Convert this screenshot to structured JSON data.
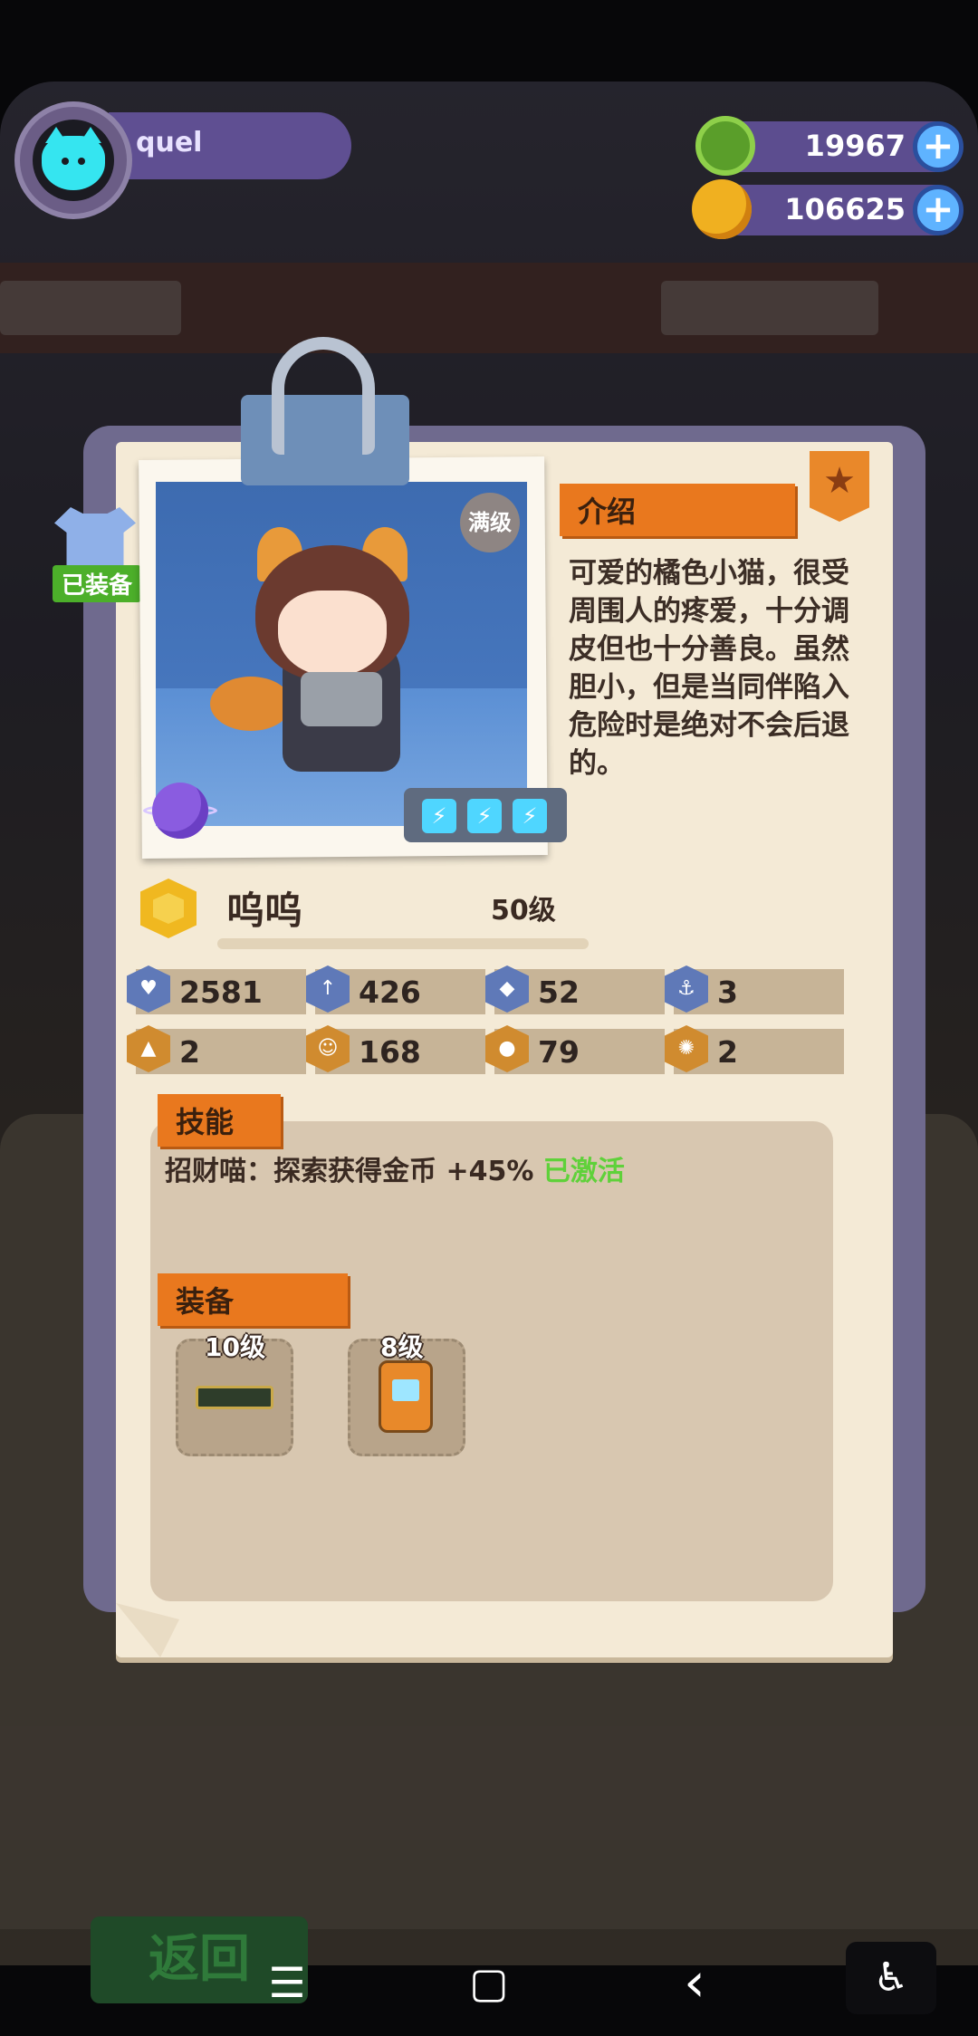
{
  "player": {
    "name": "quel"
  },
  "currencies": [
    {
      "name": "gems",
      "value": "19967",
      "icon": "green-gem-icon",
      "color": "#7fd43a"
    },
    {
      "name": "coins",
      "value": "106625",
      "icon": "gold-planet-coin-icon",
      "color": "#f0b020"
    }
  ],
  "equipped_badge": "已装备",
  "card": {
    "max_level_badge": "满级",
    "intro_header": "介绍",
    "intro_text": "可爱的橘色小猫，很受周围人的疼爱，十分调皮但也十分善良。虽然胆小，但是当同伴陷入危险时是绝对不会后退的。",
    "character_name": "呜呜",
    "character_level": "50级",
    "energy_icons": [
      "lightning-icon",
      "lightning-icon",
      "lightning-icon"
    ],
    "stats": [
      {
        "icon": "heart-shield-icon",
        "value": "2581"
      },
      {
        "icon": "sword-icon",
        "value": "426"
      },
      {
        "icon": "shield-icon",
        "value": "52"
      },
      {
        "icon": "anchor-icon",
        "value": "3"
      },
      {
        "icon": "boot-icon",
        "value": "2"
      },
      {
        "icon": "smile-icon",
        "value": "168"
      },
      {
        "icon": "muscle-icon",
        "value": "79"
      },
      {
        "icon": "brain-icon",
        "value": "2"
      }
    ],
    "skill_header": "技能",
    "skill_text": "招财喵：探索获得金币 +45% ",
    "skill_status": "已激活",
    "equip_header": "装备",
    "equipment": [
      {
        "level": "10级",
        "icon": "belt-item-icon"
      },
      {
        "level": "8级",
        "icon": "backpack-item-icon"
      }
    ]
  },
  "back_button": "返回",
  "navbar": {
    "menu": "☰",
    "home": "▢",
    "back": "‹",
    "accessibility": "♿"
  }
}
